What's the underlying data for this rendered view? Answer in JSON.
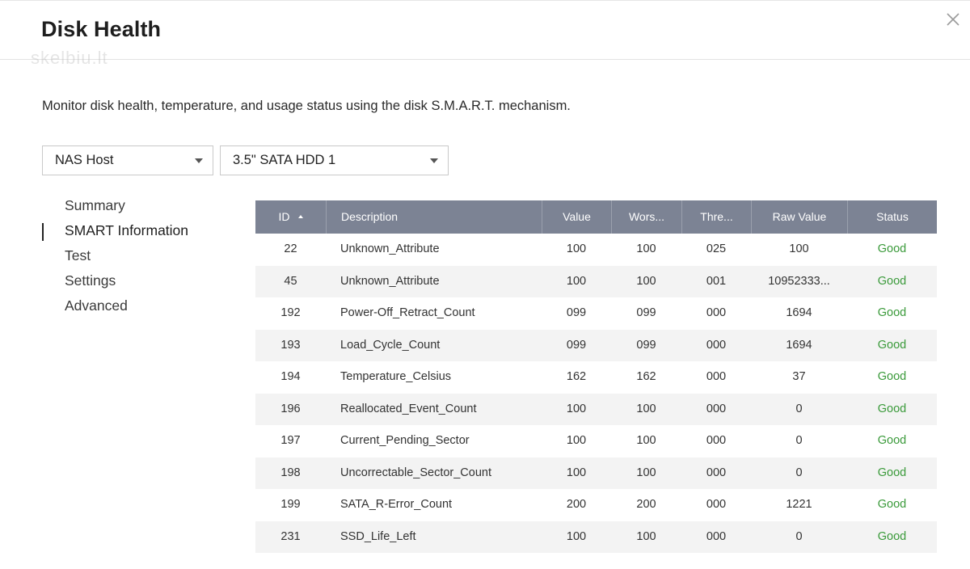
{
  "dialog": {
    "title": "Disk Health",
    "watermark": "skelbiu.lt",
    "close_label": "×"
  },
  "description": "Monitor disk health, temperature, and usage status using the disk S.M.A.R.T. mechanism.",
  "selectors": {
    "host": "NAS Host",
    "disk": "3.5\" SATA HDD 1"
  },
  "nav": {
    "items": [
      {
        "label": "Summary"
      },
      {
        "label": "SMART Information"
      },
      {
        "label": "Test"
      },
      {
        "label": "Settings"
      },
      {
        "label": "Advanced"
      }
    ],
    "active_index": 1
  },
  "table": {
    "headers": {
      "id": "ID",
      "description": "Description",
      "value": "Value",
      "worst": "Wors...",
      "threshold": "Thre...",
      "raw": "Raw Value",
      "status": "Status"
    },
    "sort": {
      "column": "id",
      "direction": "ascending"
    },
    "rows": [
      {
        "id": "22",
        "description": "Unknown_Attribute",
        "value": "100",
        "worst": "100",
        "threshold": "025",
        "raw": "100",
        "status": "Good"
      },
      {
        "id": "45",
        "description": "Unknown_Attribute",
        "value": "100",
        "worst": "100",
        "threshold": "001",
        "raw": "10952333...",
        "status": "Good"
      },
      {
        "id": "192",
        "description": "Power-Off_Retract_Count",
        "value": "099",
        "worst": "099",
        "threshold": "000",
        "raw": "1694",
        "status": "Good"
      },
      {
        "id": "193",
        "description": "Load_Cycle_Count",
        "value": "099",
        "worst": "099",
        "threshold": "000",
        "raw": "1694",
        "status": "Good"
      },
      {
        "id": "194",
        "description": "Temperature_Celsius",
        "value": "162",
        "worst": "162",
        "threshold": "000",
        "raw": "37",
        "status": "Good"
      },
      {
        "id": "196",
        "description": "Reallocated_Event_Count",
        "value": "100",
        "worst": "100",
        "threshold": "000",
        "raw": "0",
        "status": "Good"
      },
      {
        "id": "197",
        "description": "Current_Pending_Sector",
        "value": "100",
        "worst": "100",
        "threshold": "000",
        "raw": "0",
        "status": "Good"
      },
      {
        "id": "198",
        "description": "Uncorrectable_Sector_Count",
        "value": "100",
        "worst": "100",
        "threshold": "000",
        "raw": "0",
        "status": "Good"
      },
      {
        "id": "199",
        "description": "SATA_R-Error_Count",
        "value": "200",
        "worst": "200",
        "threshold": "000",
        "raw": "1221",
        "status": "Good"
      },
      {
        "id": "231",
        "description": "SSD_Life_Left",
        "value": "100",
        "worst": "100",
        "threshold": "000",
        "raw": "0",
        "status": "Good"
      }
    ]
  },
  "colors": {
    "header_bg": "#7c8394",
    "status_good": "#3a9a3a",
    "row_alt": "#f3f3f3"
  },
  "icons": {
    "close": "close-icon",
    "select_caret": "caret-down-icon",
    "sort": "sort-ascending-icon"
  }
}
